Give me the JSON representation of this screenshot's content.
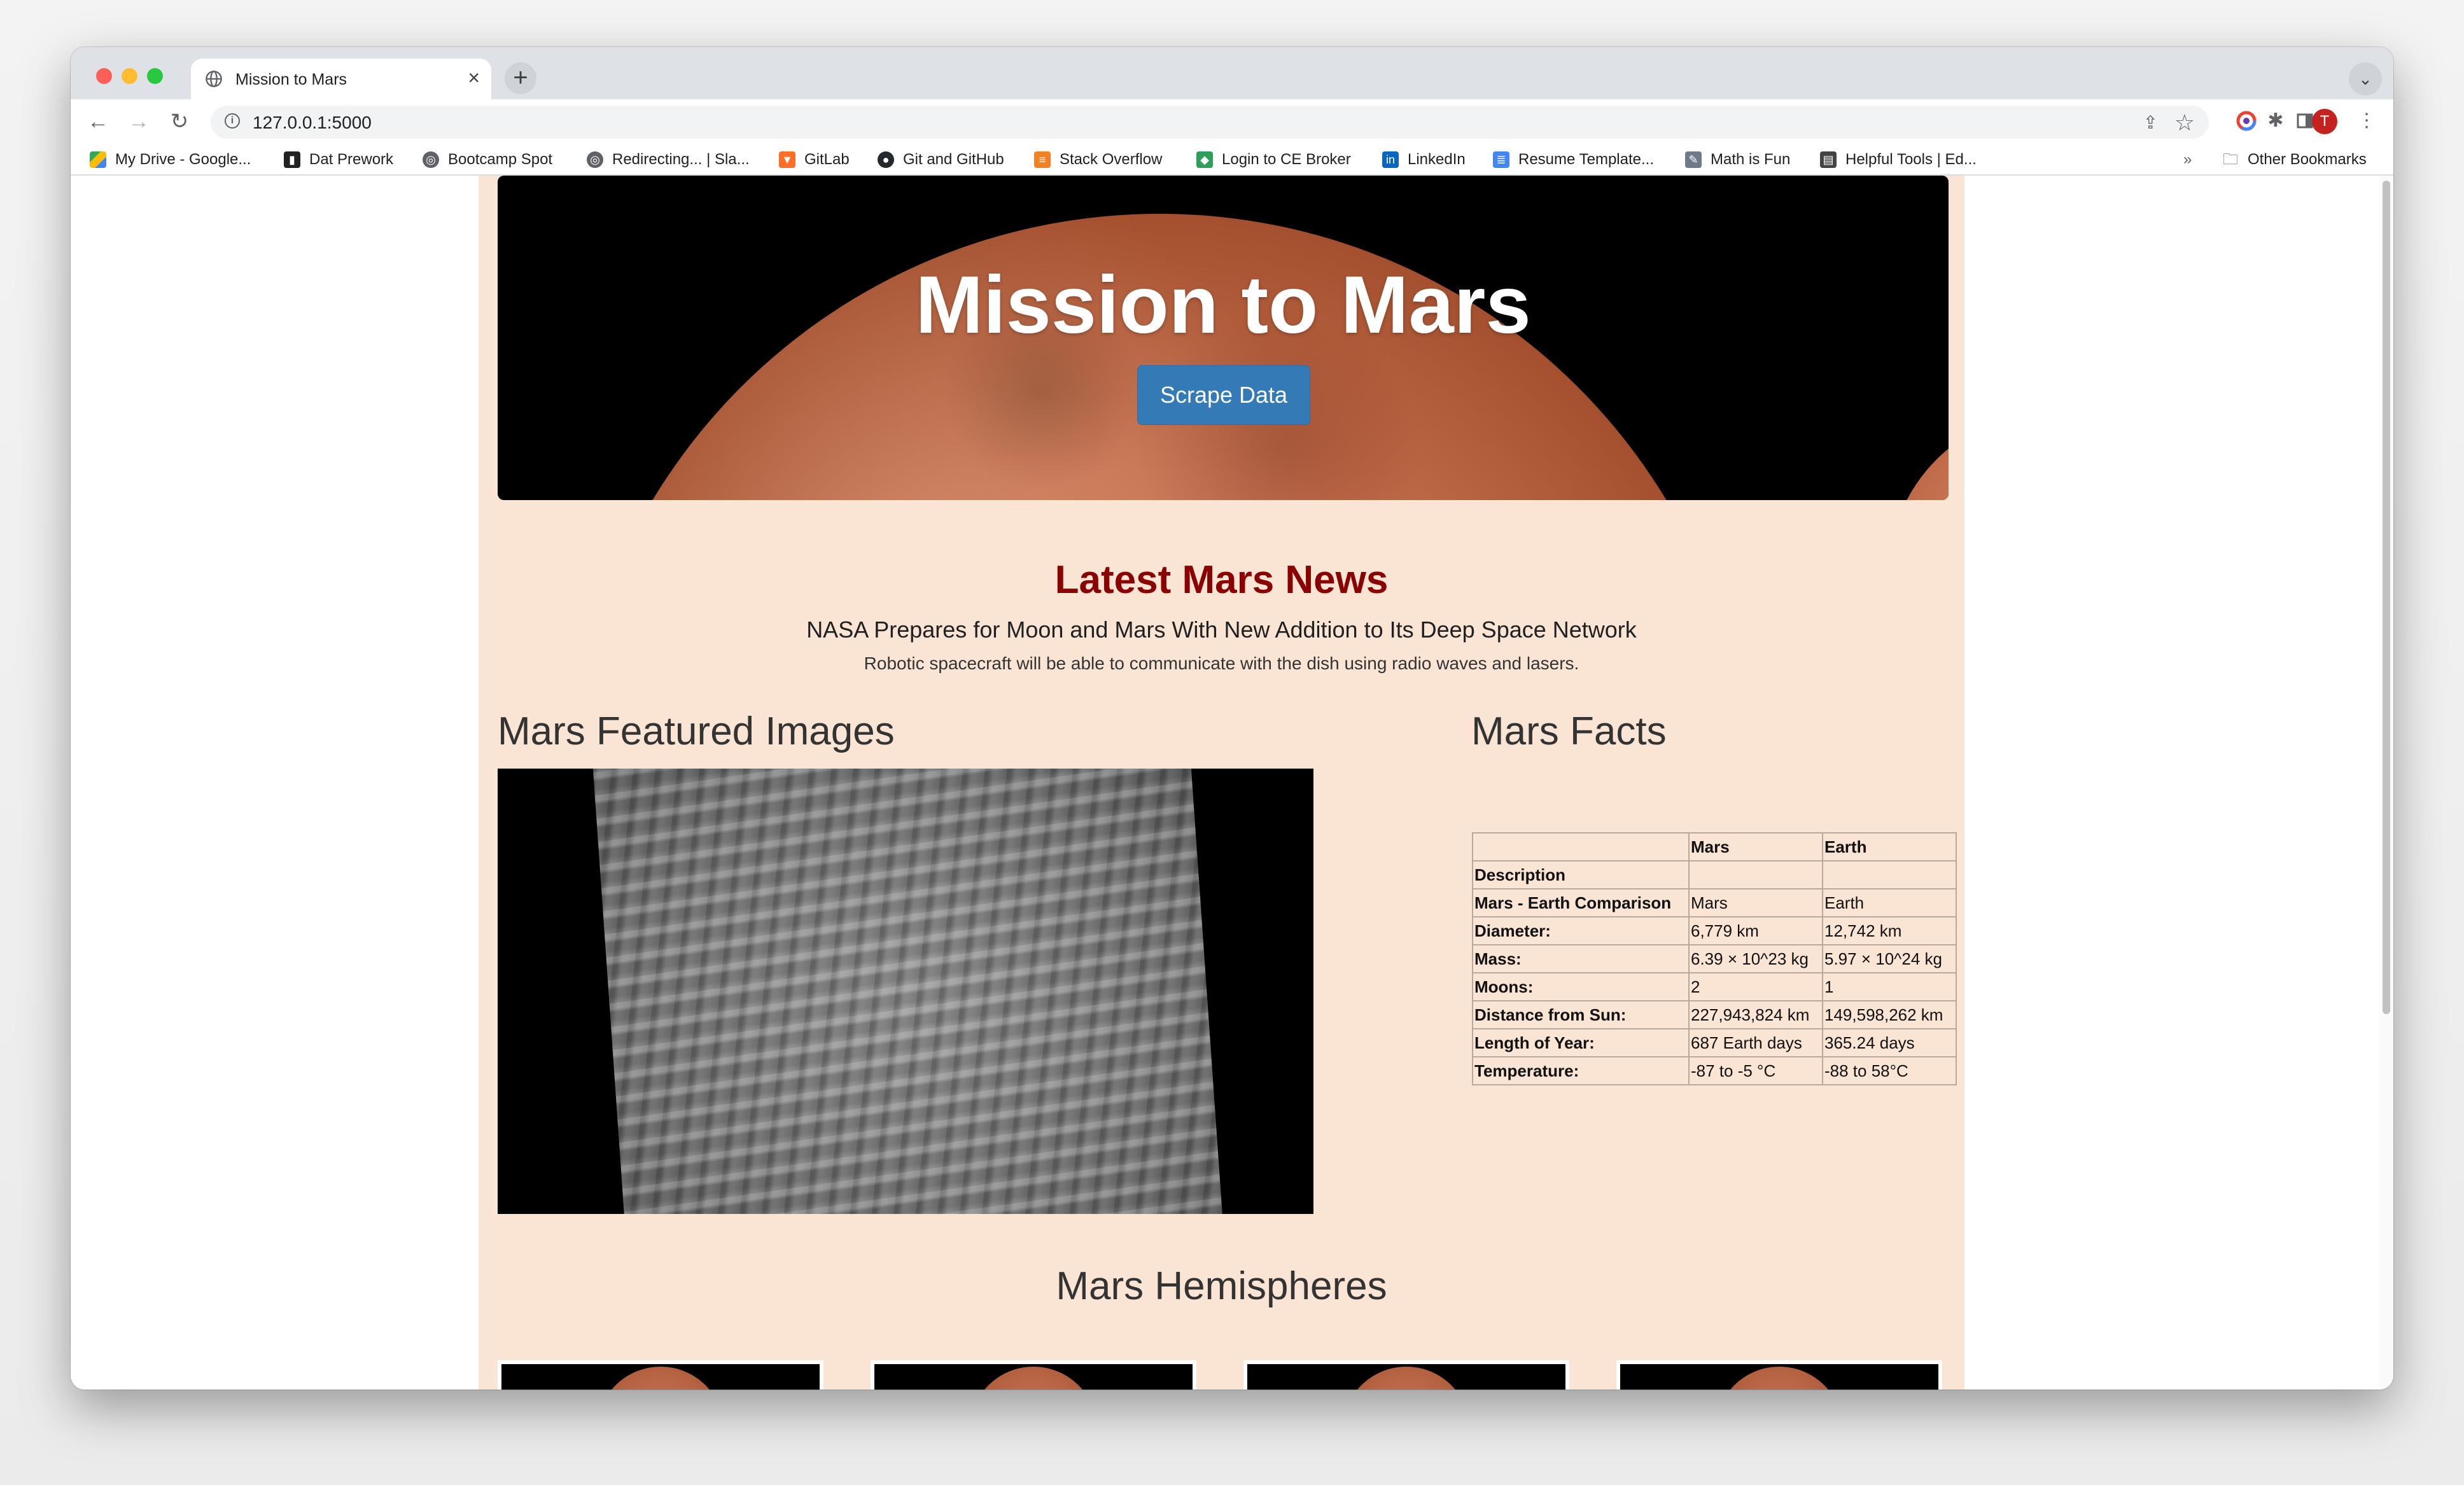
{
  "browser": {
    "tab_title": "Mission to Mars",
    "tab_close": "×",
    "new_tab": "+",
    "tab_menu": "⌄",
    "url": "127.0.0.1:5000",
    "bookmarks": [
      {
        "label": "My Drive - Google...",
        "icon": "google-drive-icon"
      },
      {
        "label": "Dat Prework",
        "icon": "book-icon"
      },
      {
        "label": "Bootcamp Spot",
        "icon": "globe-icon"
      },
      {
        "label": "Redirecting... | Sla...",
        "icon": "globe-icon"
      },
      {
        "label": "GitLab",
        "icon": "gitlab-icon"
      },
      {
        "label": "Git and GitHub",
        "icon": "github-icon"
      },
      {
        "label": "Stack Overflow",
        "icon": "stackoverflow-icon"
      },
      {
        "label": "Login to CE Broker",
        "icon": "diamond-icon"
      },
      {
        "label": "LinkedIn",
        "icon": "linkedin-icon"
      },
      {
        "label": "Resume Template...",
        "icon": "document-icon"
      },
      {
        "label": "Math is Fun",
        "icon": "math-icon"
      },
      {
        "label": "Helpful Tools | Ed...",
        "icon": "tools-icon"
      }
    ],
    "bookmarks_overflow": "»",
    "other_bookmarks": "Other Bookmarks",
    "avatar_letter": "T"
  },
  "page": {
    "jumbotron_title": "Mission to Mars",
    "scrape_button": "Scrape Data",
    "news_heading": "Latest Mars News",
    "news_title": "NASA Prepares for Moon and Mars With New Addition to Its Deep Space Network",
    "news_teaser": "Robotic spacecraft will be able to communicate with the dish using radio waves and lasers.",
    "featured_heading": "Mars Featured Images",
    "facts_heading": "Mars Facts",
    "hemispheres_heading": "Mars Hemispheres"
  },
  "facts_table": {
    "header": [
      "",
      "Mars",
      "Earth"
    ],
    "index_label": "Description",
    "rows": [
      [
        "Mars - Earth Comparison",
        "Mars",
        "Earth"
      ],
      [
        "Diameter:",
        "6,779 km",
        "12,742 km"
      ],
      [
        "Mass:",
        "6.39 × 10^23 kg",
        "5.97 × 10^24 kg"
      ],
      [
        "Moons:",
        "2",
        "1"
      ],
      [
        "Distance from Sun:",
        "227,943,824 km",
        "149,598,262 km"
      ],
      [
        "Length of Year:",
        "687 Earth days",
        "365.24 days"
      ],
      [
        "Temperature:",
        "-87 to -5 °C",
        "-88 to 58°C"
      ]
    ]
  },
  "colors": {
    "page_bg": "#fae5d5",
    "news_heading": "#8b0000",
    "button": "#337ab7"
  }
}
